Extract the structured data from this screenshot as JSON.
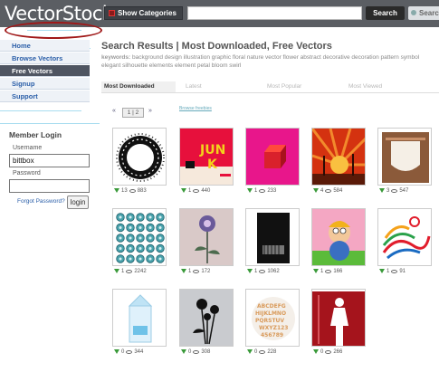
{
  "header": {
    "logo_text": "VectorStock",
    "logo_tm": "™",
    "categories_label": "Show Categories",
    "search_value": "",
    "search_button": "Search",
    "search2_button": "Searc"
  },
  "sidebar": {
    "items": [
      {
        "label": "Home"
      },
      {
        "label": "Browse Vectors"
      },
      {
        "label": "Free Vectors"
      },
      {
        "label": "Signup"
      },
      {
        "label": "Support"
      }
    ],
    "member_title": "Member Login",
    "username_label": "Username",
    "username_value": "bittbox",
    "password_label": "Password",
    "password_value": "",
    "forgot_label": "Forgot Password?",
    "login_label": "login"
  },
  "main": {
    "title": "Search Results | Most Downloaded, Free Vectors",
    "keywords_label": "keywords:",
    "keywords": "background design illustration graphic floral nature vector flower abstract decorative decoration pattern symbol elegant silhouette elements element petal bloom swirl",
    "tabs": [
      {
        "label": "Most Downloaded"
      },
      {
        "label": "Latest"
      },
      {
        "label": "Most Popular"
      },
      {
        "label": "Most Viewed"
      }
    ],
    "pager": {
      "prev": "«",
      "pages": "1 | 2",
      "next": "»"
    },
    "browse_link": "Browse freebies"
  },
  "items": [
    {
      "downloads": "13",
      "views": "883",
      "subject": "black ornamental wreath frame"
    },
    {
      "downloads": "1",
      "views": "440",
      "subject": "junk grunge typography"
    },
    {
      "downloads": "1",
      "views": "233",
      "subject": "red box on magenta"
    },
    {
      "downloads": "4",
      "views": "584",
      "subject": "sunburst palm trees"
    },
    {
      "downloads": "3",
      "views": "547",
      "subject": "grunge badge frame"
    },
    {
      "downloads": "1",
      "views": "2242",
      "subject": "teal buttons grid"
    },
    {
      "downloads": "1",
      "views": "172",
      "subject": "flower on stem"
    },
    {
      "downloads": "1",
      "views": "1062",
      "subject": "black speaker"
    },
    {
      "downloads": "1",
      "views": "166",
      "subject": "cartoon character"
    },
    {
      "downloads": "1",
      "views": "91",
      "subject": "colorful swirls"
    },
    {
      "downloads": "0",
      "views": "344",
      "subject": "milk carton"
    },
    {
      "downloads": "0",
      "views": "308",
      "subject": "black flower silhouettes"
    },
    {
      "downloads": "0",
      "views": "228",
      "subject": "alphabet letters"
    },
    {
      "downloads": "0",
      "views": "266",
      "subject": "white silhouette on red"
    }
  ],
  "colors": {
    "header_bg": "#5b5e63",
    "accent_blue": "#2a5ea8",
    "highlight_circle": "#a01818",
    "download_arrow": "#3a9a3a"
  }
}
